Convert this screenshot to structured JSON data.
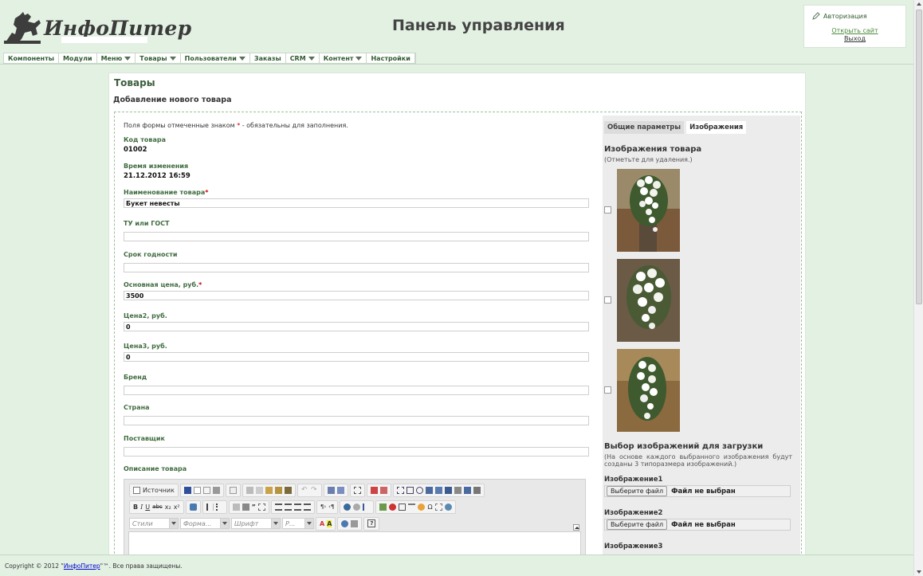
{
  "header": {
    "logo_text": "ИнфоПитер",
    "title": "Панель управления"
  },
  "auth": {
    "title": "Авторизация",
    "open_site": "Открыть сайт",
    "logout": "Выход"
  },
  "menu": [
    {
      "label": "Компоненты",
      "dropdown": false
    },
    {
      "label": "Модули",
      "dropdown": false
    },
    {
      "label": "Меню",
      "dropdown": true
    },
    {
      "label": "Товары",
      "dropdown": true
    },
    {
      "label": "Пользователи",
      "dropdown": true
    },
    {
      "label": "Заказы",
      "dropdown": false
    },
    {
      "label": "CRM",
      "dropdown": true
    },
    {
      "label": "Контент",
      "dropdown": true
    },
    {
      "label": "Настройки",
      "dropdown": false
    }
  ],
  "page": {
    "title": "Товары",
    "subtitle": "Добавление нового товара"
  },
  "form": {
    "note_before": "Поля формы отмеченные знаком",
    "note_star": "*",
    "note_after": "- обязательны для заполнения.",
    "code_label": "Код товара",
    "code_value": "01002",
    "time_label": "Время изменения",
    "time_value": "21.12.2012 16:59",
    "name_label": "Наименование товара",
    "name_value": "Букет невесты",
    "tu_label": "ТУ или ГОСТ",
    "tu_value": "",
    "shelf_label": "Срок годности",
    "shelf_value": "",
    "price_label": "Основная цена, руб.",
    "price_value": "3500",
    "price2_label": "Цена2, руб.",
    "price2_value": "0",
    "price3_label": "Цена3, руб.",
    "price3_value": "0",
    "brand_label": "Бренд",
    "brand_value": "",
    "country_label": "Страна",
    "country_value": "",
    "supplier_label": "Поставщик",
    "supplier_value": "",
    "desc_label": "Описание товара",
    "req_mark": "*"
  },
  "editor": {
    "source_label": "Источник",
    "styles_placeholder": "Стили",
    "format_placeholder": "Форма...",
    "font_placeholder": "Шрифт",
    "size_placeholder": "Р..."
  },
  "side": {
    "tab_general": "Общие параметры",
    "tab_images": "Изображения",
    "images_title": "Изображения товара",
    "images_hint": "(Отметьте для удаления.)",
    "upload_title": "Выбор изображений для загрузки",
    "upload_hint": "(На основе каждого выбранного изображения будут созданы 3 типоразмера изображений.)",
    "uploads": [
      {
        "label": "Изображение1",
        "button": "Выберите файл",
        "status": "Файл не выбран"
      },
      {
        "label": "Изображение2",
        "button": "Выберите файл",
        "status": "Файл не выбран"
      },
      {
        "label": "Изображение3"
      }
    ]
  },
  "footer": {
    "prefix": "Copyright © 2012 \"",
    "link": "ИнфоПитер",
    "suffix": "\"™. Все права защищены."
  },
  "colors": {
    "background": "#e3f1e3",
    "heading_green": "#3b5d3b",
    "required_star": "#cc0000",
    "link_blue": "#0000cc"
  }
}
